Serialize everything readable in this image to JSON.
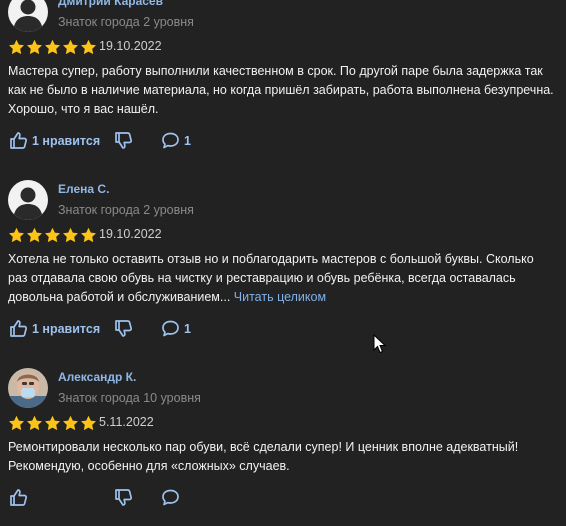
{
  "reviews": [
    {
      "author": "Дмитрий Карасев",
      "level": "Знаток города 2 уровня",
      "rating": 5,
      "date": "19.10.2022",
      "text": "Мастера супер, работу выполнили качественном в срок. По другой паре была задержка так как не было в наличие материала, но когда пришёл забирать, работа выполнена безупречна. Хорошо, что я вас нашёл.",
      "read_more": "",
      "likes_label": "1 нравится",
      "comments_count": "1",
      "avatar": "default-user-icon"
    },
    {
      "author": "Елена С.",
      "level": "Знаток города 2 уровня",
      "rating": 5,
      "date": "19.10.2022",
      "text": "Хотела не только оставить отзыв но и поблагодарить мастеров с большой буквы. Сколько раз отдавала свою обувь на чистку и реставрацию и обувь ребёнка, всегда оставалась довольна работой и обслуживанием...",
      "read_more": "Читать целиком",
      "likes_label": "1 нравится",
      "comments_count": "1",
      "avatar": "default-user-icon"
    },
    {
      "author": "Александр К.",
      "level": "Знаток города 10 уровня",
      "rating": 5,
      "date": "5.11.2022",
      "text": "Ремонтировали несколько пар обуви, всё сделали супер! И ценник вполне адекватный! Рекомендую, особенно для «сложных» случаев.",
      "read_more": "",
      "likes_label": "",
      "comments_count": "",
      "avatar": "photo-avatar"
    }
  ],
  "colors": {
    "background": "#222222",
    "star": "#fcc419",
    "link": "#8fb8e6",
    "action": "#9ec2ee",
    "muted": "#8a8a8a"
  },
  "icons": {
    "star": "star-icon",
    "like": "thumbs-up-icon",
    "dislike": "thumbs-down-icon",
    "comment": "speech-bubble-icon",
    "cursor": "mouse-pointer-icon"
  }
}
